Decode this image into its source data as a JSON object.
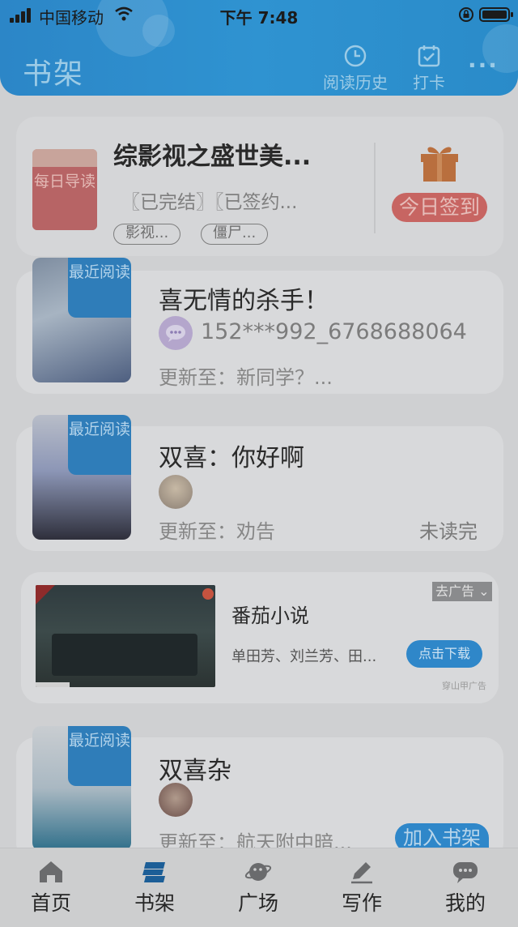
{
  "status_bar": {
    "carrier": "中国移动",
    "time": "下午 7:48"
  },
  "header": {
    "title": "书架",
    "history_label": "阅读历史",
    "checkin_label": "打卡",
    "more_label": "···"
  },
  "daily_card": {
    "badge": "每日导读",
    "title": "综影视之盛世美...",
    "tags_text": "〖已完结〗〖已签约...",
    "chips": [
      "影视...",
      "僵尸..."
    ],
    "signin_label": "今日签到"
  },
  "books": [
    {
      "badge": "最近阅读",
      "title": "喜无情的杀手！",
      "author": "152***992_6768688064",
      "update": "更新至：新同学？..."
    },
    {
      "badge": "最近阅读",
      "title": "双喜：你好啊",
      "update": "更新至：劝告",
      "status": "未读完"
    },
    {
      "badge": "最近阅读",
      "title": "双喜杂",
      "update": "更新至：航天附中暗...",
      "action": "加入书架"
    }
  ],
  "ad": {
    "close_label": "去广告",
    "title": "番茄小说",
    "desc": "单田芳、刘兰芳、田...",
    "button": "点击下载",
    "source": "穿山甲广告"
  },
  "tabs": [
    "首页",
    "书架",
    "广场",
    "写作",
    "我的"
  ],
  "colors": {
    "accent": "#2f87c9",
    "signin": "#c76562",
    "overlay_bg": "#cfd0d2"
  }
}
